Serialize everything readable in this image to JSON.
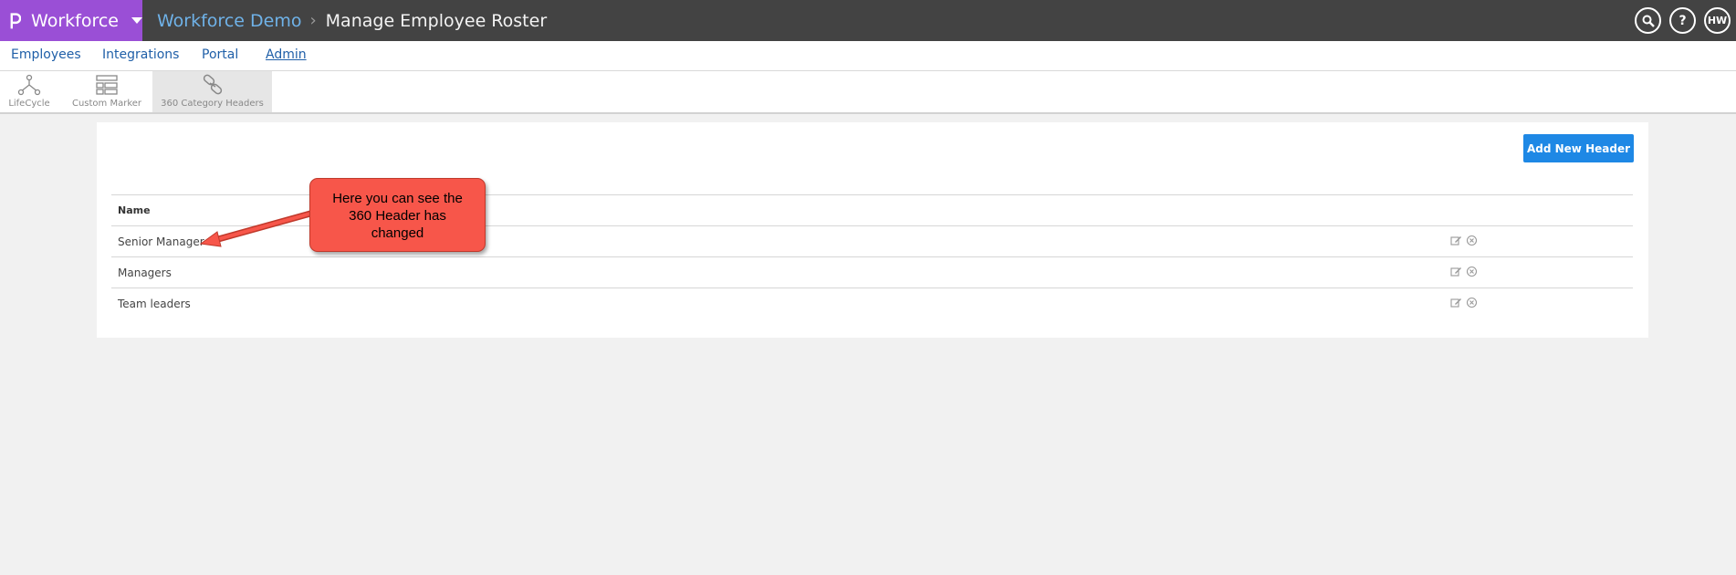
{
  "app": {
    "brand": "Workforce",
    "breadcrumb": [
      "Workforce Demo",
      "Manage Employee Roster"
    ],
    "user_initials": "HW"
  },
  "nav": {
    "items": [
      "Employees",
      "Integrations",
      "Portal",
      "Admin"
    ],
    "active": "Admin"
  },
  "tools": [
    {
      "label": "LifeCycle",
      "icon": "lifecycle-icon"
    },
    {
      "label": "Custom Marker",
      "icon": "custom-marker-icon"
    },
    {
      "label": "360 Category Headers",
      "icon": "link-chain-icon",
      "selected": true
    }
  ],
  "content": {
    "add_button": "Add New Header",
    "table": {
      "header": "Name",
      "rows": [
        "Senior Manager",
        "Managers",
        "Team leaders"
      ]
    }
  },
  "annotation": {
    "lines": [
      "Here you can see the",
      "360 Header has",
      "changed"
    ]
  },
  "colors": {
    "brand": "#9a4fd6",
    "topbar": "#434343",
    "accent": "#1e88e5",
    "link": "#1f5fa8",
    "callout": "#f7564a"
  }
}
